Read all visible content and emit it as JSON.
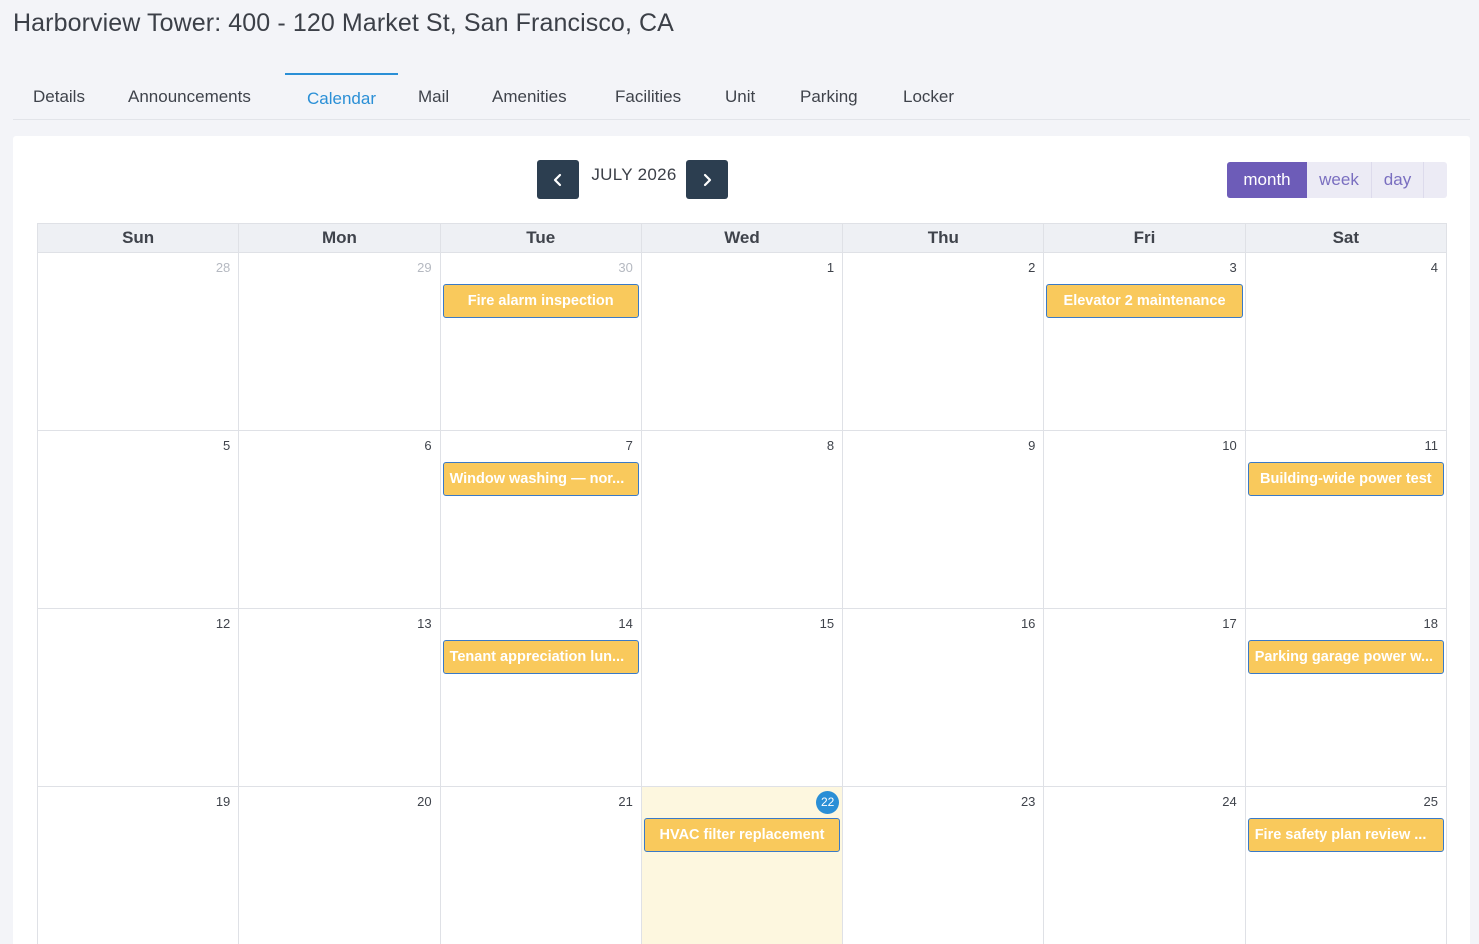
{
  "page": {
    "title": "Harborview Tower: 400 - 120 Market St, San Francisco, CA"
  },
  "tabs": [
    {
      "label": "Details"
    },
    {
      "label": "Announcements"
    },
    {
      "label": "Calendar",
      "active": true
    },
    {
      "label": "Mail"
    },
    {
      "label": "Amenities"
    },
    {
      "label": "Facilities"
    },
    {
      "label": "Unit"
    },
    {
      "label": "Parking"
    },
    {
      "label": "Locker"
    }
  ],
  "calendar": {
    "month_label": "JULY 2026",
    "prev_icon": "chevron-left-icon",
    "next_icon": "chevron-right-icon",
    "views": [
      {
        "label": "month",
        "active": true
      },
      {
        "label": "week"
      },
      {
        "label": "day"
      }
    ],
    "weekdays": [
      "Sun",
      "Mon",
      "Tue",
      "Wed",
      "Thu",
      "Fri",
      "Sat"
    ],
    "weeks": [
      {
        "days": [
          {
            "num": "28",
            "other": true
          },
          {
            "num": "29",
            "other": true
          },
          {
            "num": "30",
            "other": true,
            "event": "Fire alarm inspection"
          },
          {
            "num": "1"
          },
          {
            "num": "2"
          },
          {
            "num": "3",
            "event": "Elevator 2 maintenance"
          },
          {
            "num": "4"
          }
        ]
      },
      {
        "days": [
          {
            "num": "5"
          },
          {
            "num": "6"
          },
          {
            "num": "7",
            "event": "Window washing — nor..."
          },
          {
            "num": "8"
          },
          {
            "num": "9"
          },
          {
            "num": "10"
          },
          {
            "num": "11",
            "event": "Building-wide power test"
          }
        ]
      },
      {
        "days": [
          {
            "num": "12"
          },
          {
            "num": "13"
          },
          {
            "num": "14",
            "event": "Tenant appreciation lun..."
          },
          {
            "num": "15"
          },
          {
            "num": "16"
          },
          {
            "num": "17"
          },
          {
            "num": "18",
            "event": "Parking garage power w..."
          }
        ]
      },
      {
        "days": [
          {
            "num": "19"
          },
          {
            "num": "20"
          },
          {
            "num": "21"
          },
          {
            "num": "22",
            "today": true,
            "event": "HVAC filter replacement"
          },
          {
            "num": "23"
          },
          {
            "num": "24"
          },
          {
            "num": "25",
            "event": "Fire safety plan review ..."
          }
        ]
      }
    ]
  },
  "colors": {
    "accent": "#2a8fd6",
    "nav_button": "#2c3e50",
    "view_active": "#6d5cb8",
    "event_fill": "#f9c95c",
    "event_border": "#3a7ac7",
    "today_bg": "#fdf7df"
  }
}
